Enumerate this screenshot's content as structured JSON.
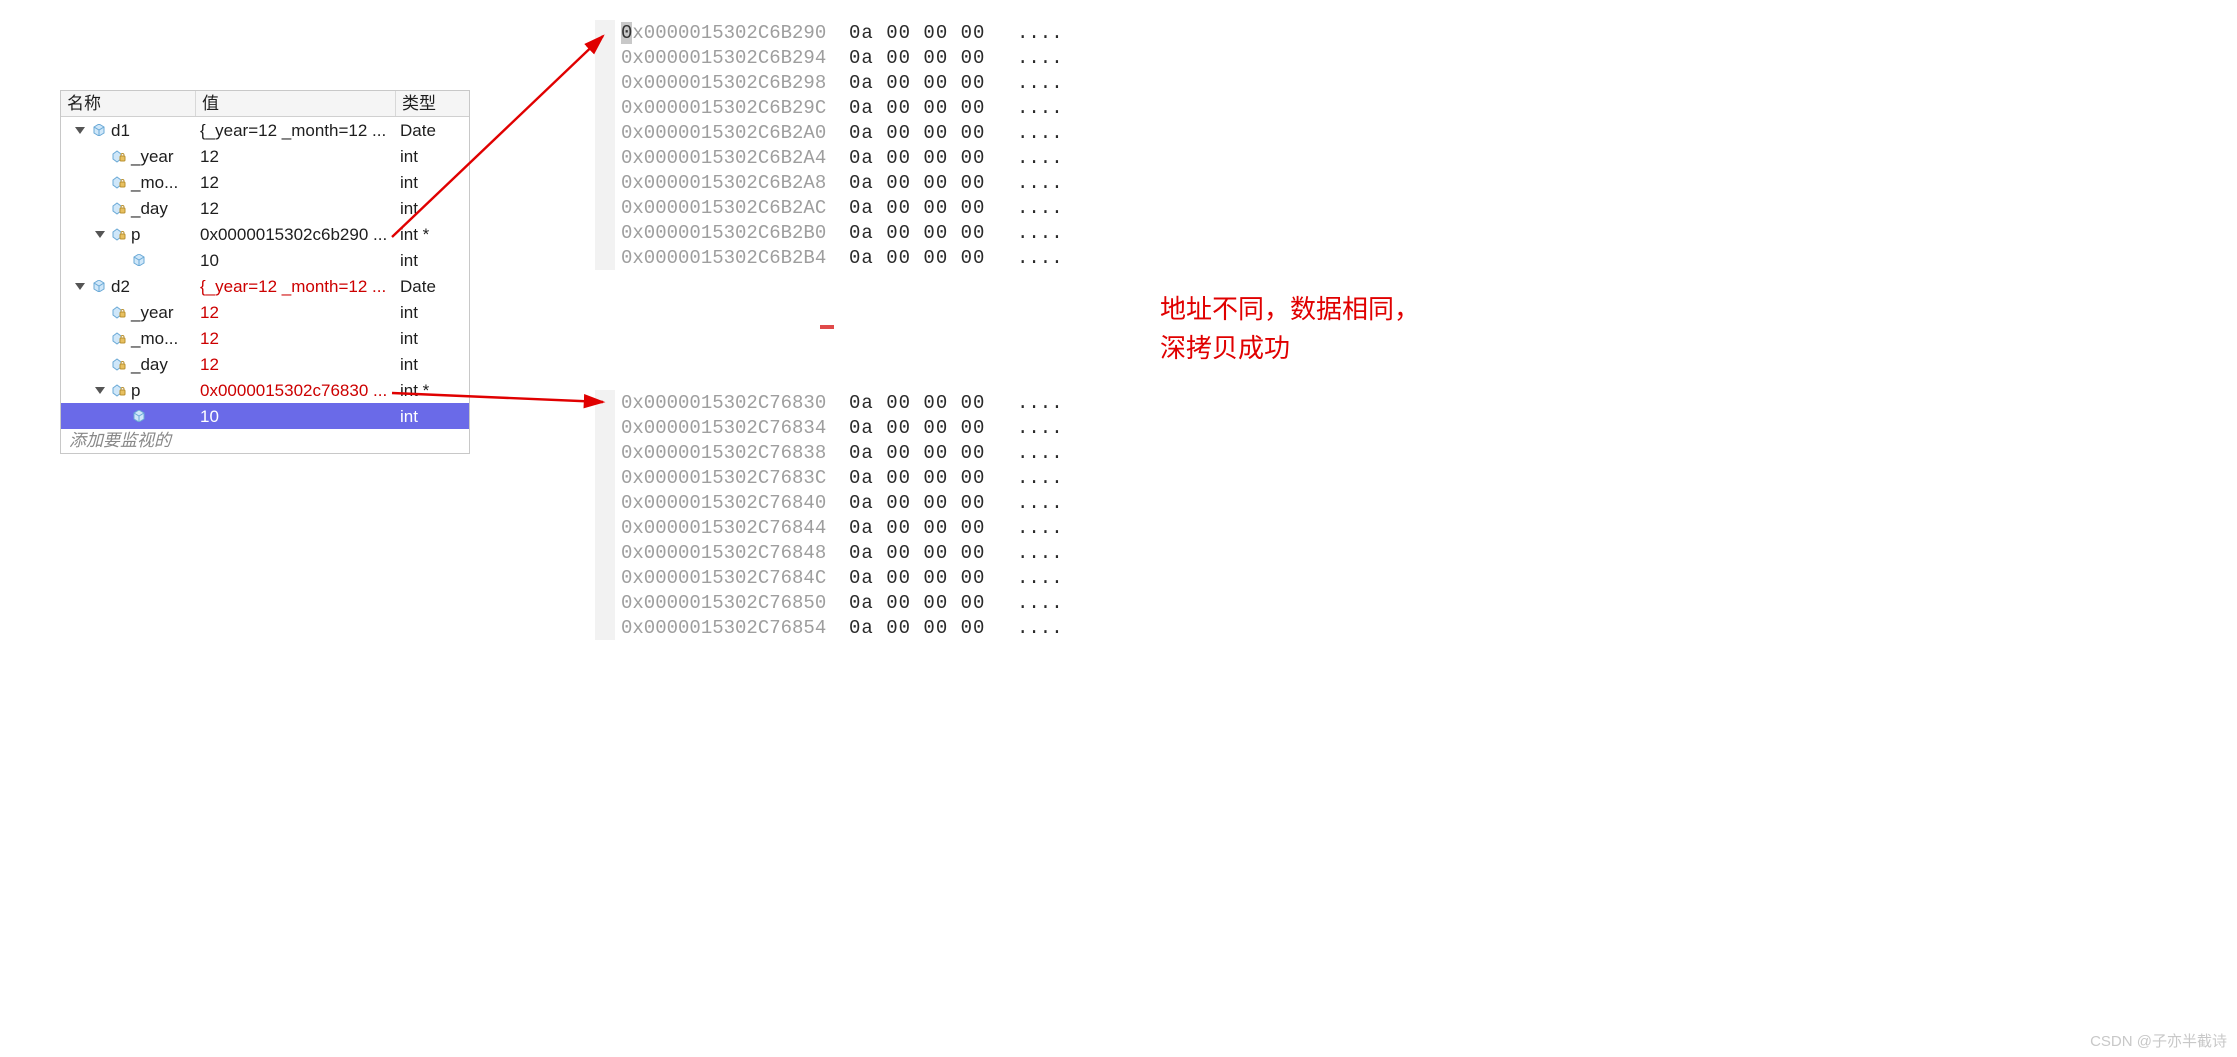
{
  "watch": {
    "headers": {
      "name": "名称",
      "value": "值",
      "type": "类型"
    },
    "rows": [
      {
        "indent": 0,
        "expand": true,
        "icon": "cube",
        "name": "d1",
        "value": "{_year=12 _month=12 ...",
        "type": "Date",
        "red": false,
        "selected": false
      },
      {
        "indent": 1,
        "expand": false,
        "icon": "lock",
        "name": "_year",
        "value": "12",
        "type": "int",
        "red": false,
        "selected": false
      },
      {
        "indent": 1,
        "expand": false,
        "icon": "lock",
        "name": "_mo...",
        "value": "12",
        "type": "int",
        "red": false,
        "selected": false
      },
      {
        "indent": 1,
        "expand": false,
        "icon": "lock",
        "name": "_day",
        "value": "12",
        "type": "int",
        "red": false,
        "selected": false
      },
      {
        "indent": 1,
        "expand": true,
        "icon": "lock",
        "name": "p",
        "value": "0x0000015302c6b290 ...",
        "type": "int *",
        "red": false,
        "selected": false
      },
      {
        "indent": 2,
        "expand": false,
        "icon": "cube",
        "name": "",
        "value": "10",
        "type": "int",
        "red": false,
        "selected": false
      },
      {
        "indent": 0,
        "expand": true,
        "icon": "cube",
        "name": "d2",
        "value": "{_year=12 _month=12 ...",
        "type": "Date",
        "red": true,
        "selected": false
      },
      {
        "indent": 1,
        "expand": false,
        "icon": "lock",
        "name": "_year",
        "value": "12",
        "type": "int",
        "red": true,
        "selected": false
      },
      {
        "indent": 1,
        "expand": false,
        "icon": "lock",
        "name": "_mo...",
        "value": "12",
        "type": "int",
        "red": true,
        "selected": false
      },
      {
        "indent": 1,
        "expand": false,
        "icon": "lock",
        "name": "_day",
        "value": "12",
        "type": "int",
        "red": true,
        "selected": false
      },
      {
        "indent": 1,
        "expand": true,
        "icon": "lock",
        "name": "p",
        "value": "0x0000015302c76830 ...",
        "type": "int *",
        "red": true,
        "selected": false
      },
      {
        "indent": 2,
        "expand": false,
        "icon": "cube",
        "name": "",
        "value": "10",
        "type": "int",
        "red": true,
        "selected": true
      }
    ],
    "footer": "添加要监视的"
  },
  "memory": {
    "top": [
      {
        "addr": "0x0000015302C6B290",
        "bytes": "0a 00 00 00",
        "ascii": "....",
        "hi": true
      },
      {
        "addr": "0x0000015302C6B294",
        "bytes": "0a 00 00 00",
        "ascii": "...."
      },
      {
        "addr": "0x0000015302C6B298",
        "bytes": "0a 00 00 00",
        "ascii": "...."
      },
      {
        "addr": "0x0000015302C6B29C",
        "bytes": "0a 00 00 00",
        "ascii": "...."
      },
      {
        "addr": "0x0000015302C6B2A0",
        "bytes": "0a 00 00 00",
        "ascii": "...."
      },
      {
        "addr": "0x0000015302C6B2A4",
        "bytes": "0a 00 00 00",
        "ascii": "...."
      },
      {
        "addr": "0x0000015302C6B2A8",
        "bytes": "0a 00 00 00",
        "ascii": "...."
      },
      {
        "addr": "0x0000015302C6B2AC",
        "bytes": "0a 00 00 00",
        "ascii": "...."
      },
      {
        "addr": "0x0000015302C6B2B0",
        "bytes": "0a 00 00 00",
        "ascii": "...."
      },
      {
        "addr": "0x0000015302C6B2B4",
        "bytes": "0a 00 00 00",
        "ascii": "...."
      }
    ],
    "bottom": [
      {
        "addr": "0x0000015302C76830",
        "bytes": "0a 00 00 00",
        "ascii": "...."
      },
      {
        "addr": "0x0000015302C76834",
        "bytes": "0a 00 00 00",
        "ascii": "...."
      },
      {
        "addr": "0x0000015302C76838",
        "bytes": "0a 00 00 00",
        "ascii": "...."
      },
      {
        "addr": "0x0000015302C7683C",
        "bytes": "0a 00 00 00",
        "ascii": "...."
      },
      {
        "addr": "0x0000015302C76840",
        "bytes": "0a 00 00 00",
        "ascii": "...."
      },
      {
        "addr": "0x0000015302C76844",
        "bytes": "0a 00 00 00",
        "ascii": "...."
      },
      {
        "addr": "0x0000015302C76848",
        "bytes": "0a 00 00 00",
        "ascii": "...."
      },
      {
        "addr": "0x0000015302C7684C",
        "bytes": "0a 00 00 00",
        "ascii": "...."
      },
      {
        "addr": "0x0000015302C76850",
        "bytes": "0a 00 00 00",
        "ascii": "...."
      },
      {
        "addr": "0x0000015302C76854",
        "bytes": "0a 00 00 00",
        "ascii": "...."
      }
    ]
  },
  "annotation": {
    "line1": "地址不同，数据相同，",
    "line2": "深拷贝成功"
  },
  "watermark": "CSDN @子亦半截诗"
}
